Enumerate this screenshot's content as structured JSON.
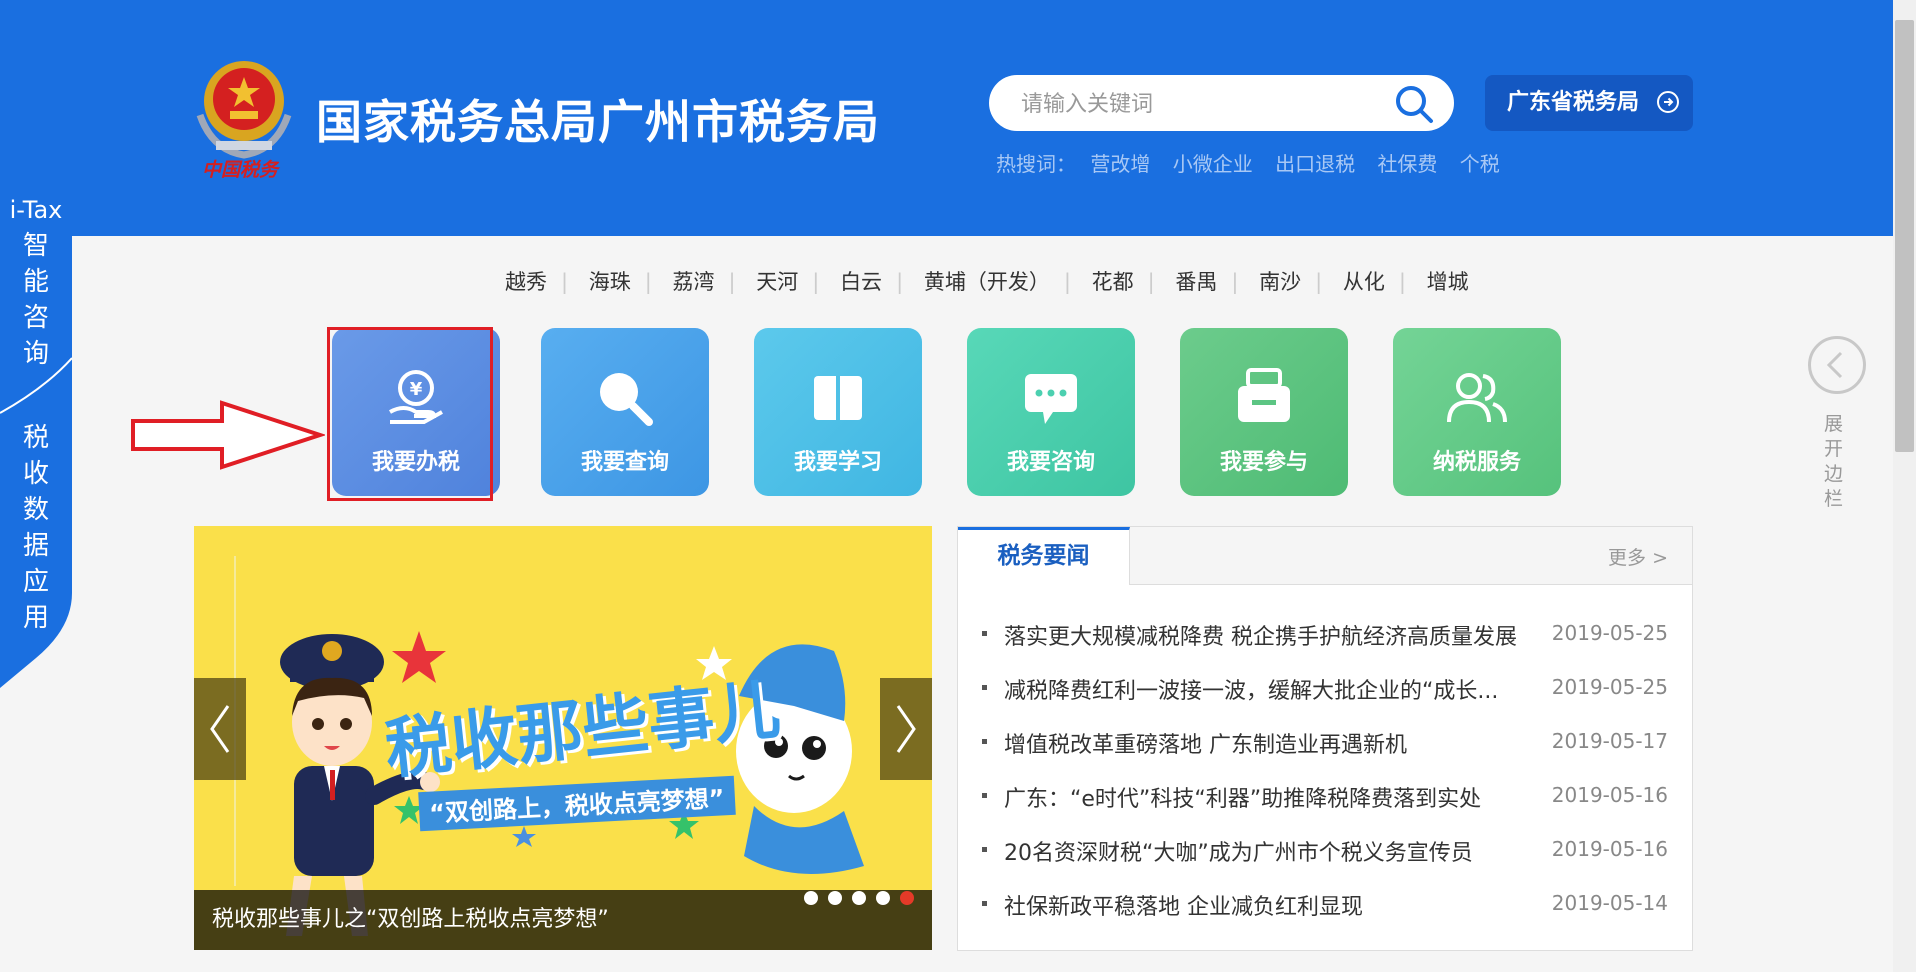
{
  "header": {
    "site_title": "国家税务总局广州市税务局",
    "emblem_caption": "中国税务",
    "search": {
      "placeholder": "请输入关键词"
    },
    "province_button": "广东省税务局",
    "hot_label": "热搜词：",
    "hot_words": [
      "营改增",
      "小微企业",
      "出口退税",
      "社保费",
      "个税"
    ]
  },
  "side_tab": {
    "top_label": "i-Tax",
    "top_chars": [
      "智",
      "能",
      "咨",
      "询"
    ],
    "bottom_chars": [
      "税",
      "收",
      "数",
      "据",
      "应",
      "用"
    ]
  },
  "districts": [
    "越秀",
    "海珠",
    "荔湾",
    "天河",
    "白云",
    "黄埔（开发）",
    "花都",
    "番禺",
    "南沙",
    "从化",
    "增城"
  ],
  "services": [
    {
      "label": "我要办税",
      "icon": "yuan-hand-icon",
      "color": "#5b8ee6"
    },
    {
      "label": "我要查询",
      "icon": "magnifier-icon",
      "color": "#4aa3ea"
    },
    {
      "label": "我要学习",
      "icon": "book-icon",
      "color": "#4ec0e6"
    },
    {
      "label": "我要咨询",
      "icon": "chat-bubble-icon",
      "color": "#4cd0b0"
    },
    {
      "label": "我要参与",
      "icon": "ballot-box-icon",
      "color": "#5cc583"
    },
    {
      "label": "纳税服务",
      "icon": "users-icon",
      "color": "#6ad08c"
    }
  ],
  "expand_sidebar": {
    "chars": [
      "展",
      "开",
      "边",
      "栏"
    ]
  },
  "banner": {
    "title": "税收那些事儿",
    "subtitle": "“双创路上，税收点亮梦想”",
    "caption": "税收那些事儿之“双创路上税收点亮梦想”",
    "dots_total": 5,
    "active_dot": 5
  },
  "news": {
    "tab_label": "税务要闻",
    "more_label": "更多 >",
    "items": [
      {
        "title": "落实更大规模减税降费 税企携手护航经济高质量发展",
        "date": "2019-05-25"
      },
      {
        "title": "减税降费红利一波接一波，缓解大批企业的“成长...",
        "date": "2019-05-25"
      },
      {
        "title": "增值税改革重磅落地 广东制造业再遇新机",
        "date": "2019-05-17"
      },
      {
        "title": "广东：“e时代”科技“利器”助推降税降费落到实处",
        "date": "2019-05-16"
      },
      {
        "title": "20名资深财税“大咖”成为广州市个税义务宣传员",
        "date": "2019-05-16"
      },
      {
        "title": "社保新政平稳落地 企业减负红利显现",
        "date": "2019-05-14"
      }
    ]
  },
  "colors": {
    "header_blue": "#1a6fe0",
    "highlight_red": "#e01e25",
    "banner_yellow": "#fae04a"
  }
}
